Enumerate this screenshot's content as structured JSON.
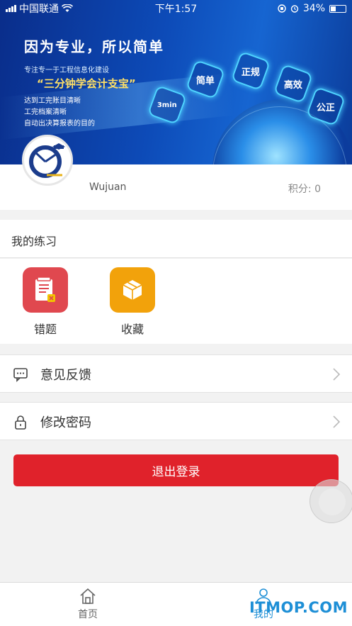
{
  "status_bar": {
    "carrier": "中国联通",
    "time": "下午1:57",
    "battery": "34%",
    "battery_level": 0.34
  },
  "banner": {
    "headline": "因为专业，所以简单",
    "subtitle": "专注专一于工程信息化建设",
    "slogan": "“三分钟学会计支宝”",
    "lines": [
      "达到工完账目清晰",
      "工完档案清晰",
      "自动出决算报表的目的"
    ],
    "hex_tags": [
      "3min",
      "简单",
      "正规",
      "高效",
      "公正"
    ]
  },
  "profile": {
    "username": "Wujuan",
    "points": "积分: 0"
  },
  "practice": {
    "title": "我的练习",
    "items": [
      {
        "label": "错题",
        "color": "#e0484f"
      },
      {
        "label": "收藏",
        "color": "#f2a20b"
      }
    ]
  },
  "menu": {
    "feedback": "意见反馈",
    "change_password": "修改密码"
  },
  "logout": {
    "label": "退出登录",
    "color": "#e0222b"
  },
  "tabbar": {
    "home": {
      "label": "首页",
      "color": "#666666"
    },
    "mine": {
      "label": "我的",
      "color": "#1e8fd6"
    }
  },
  "watermark": "ITMOP.COM"
}
